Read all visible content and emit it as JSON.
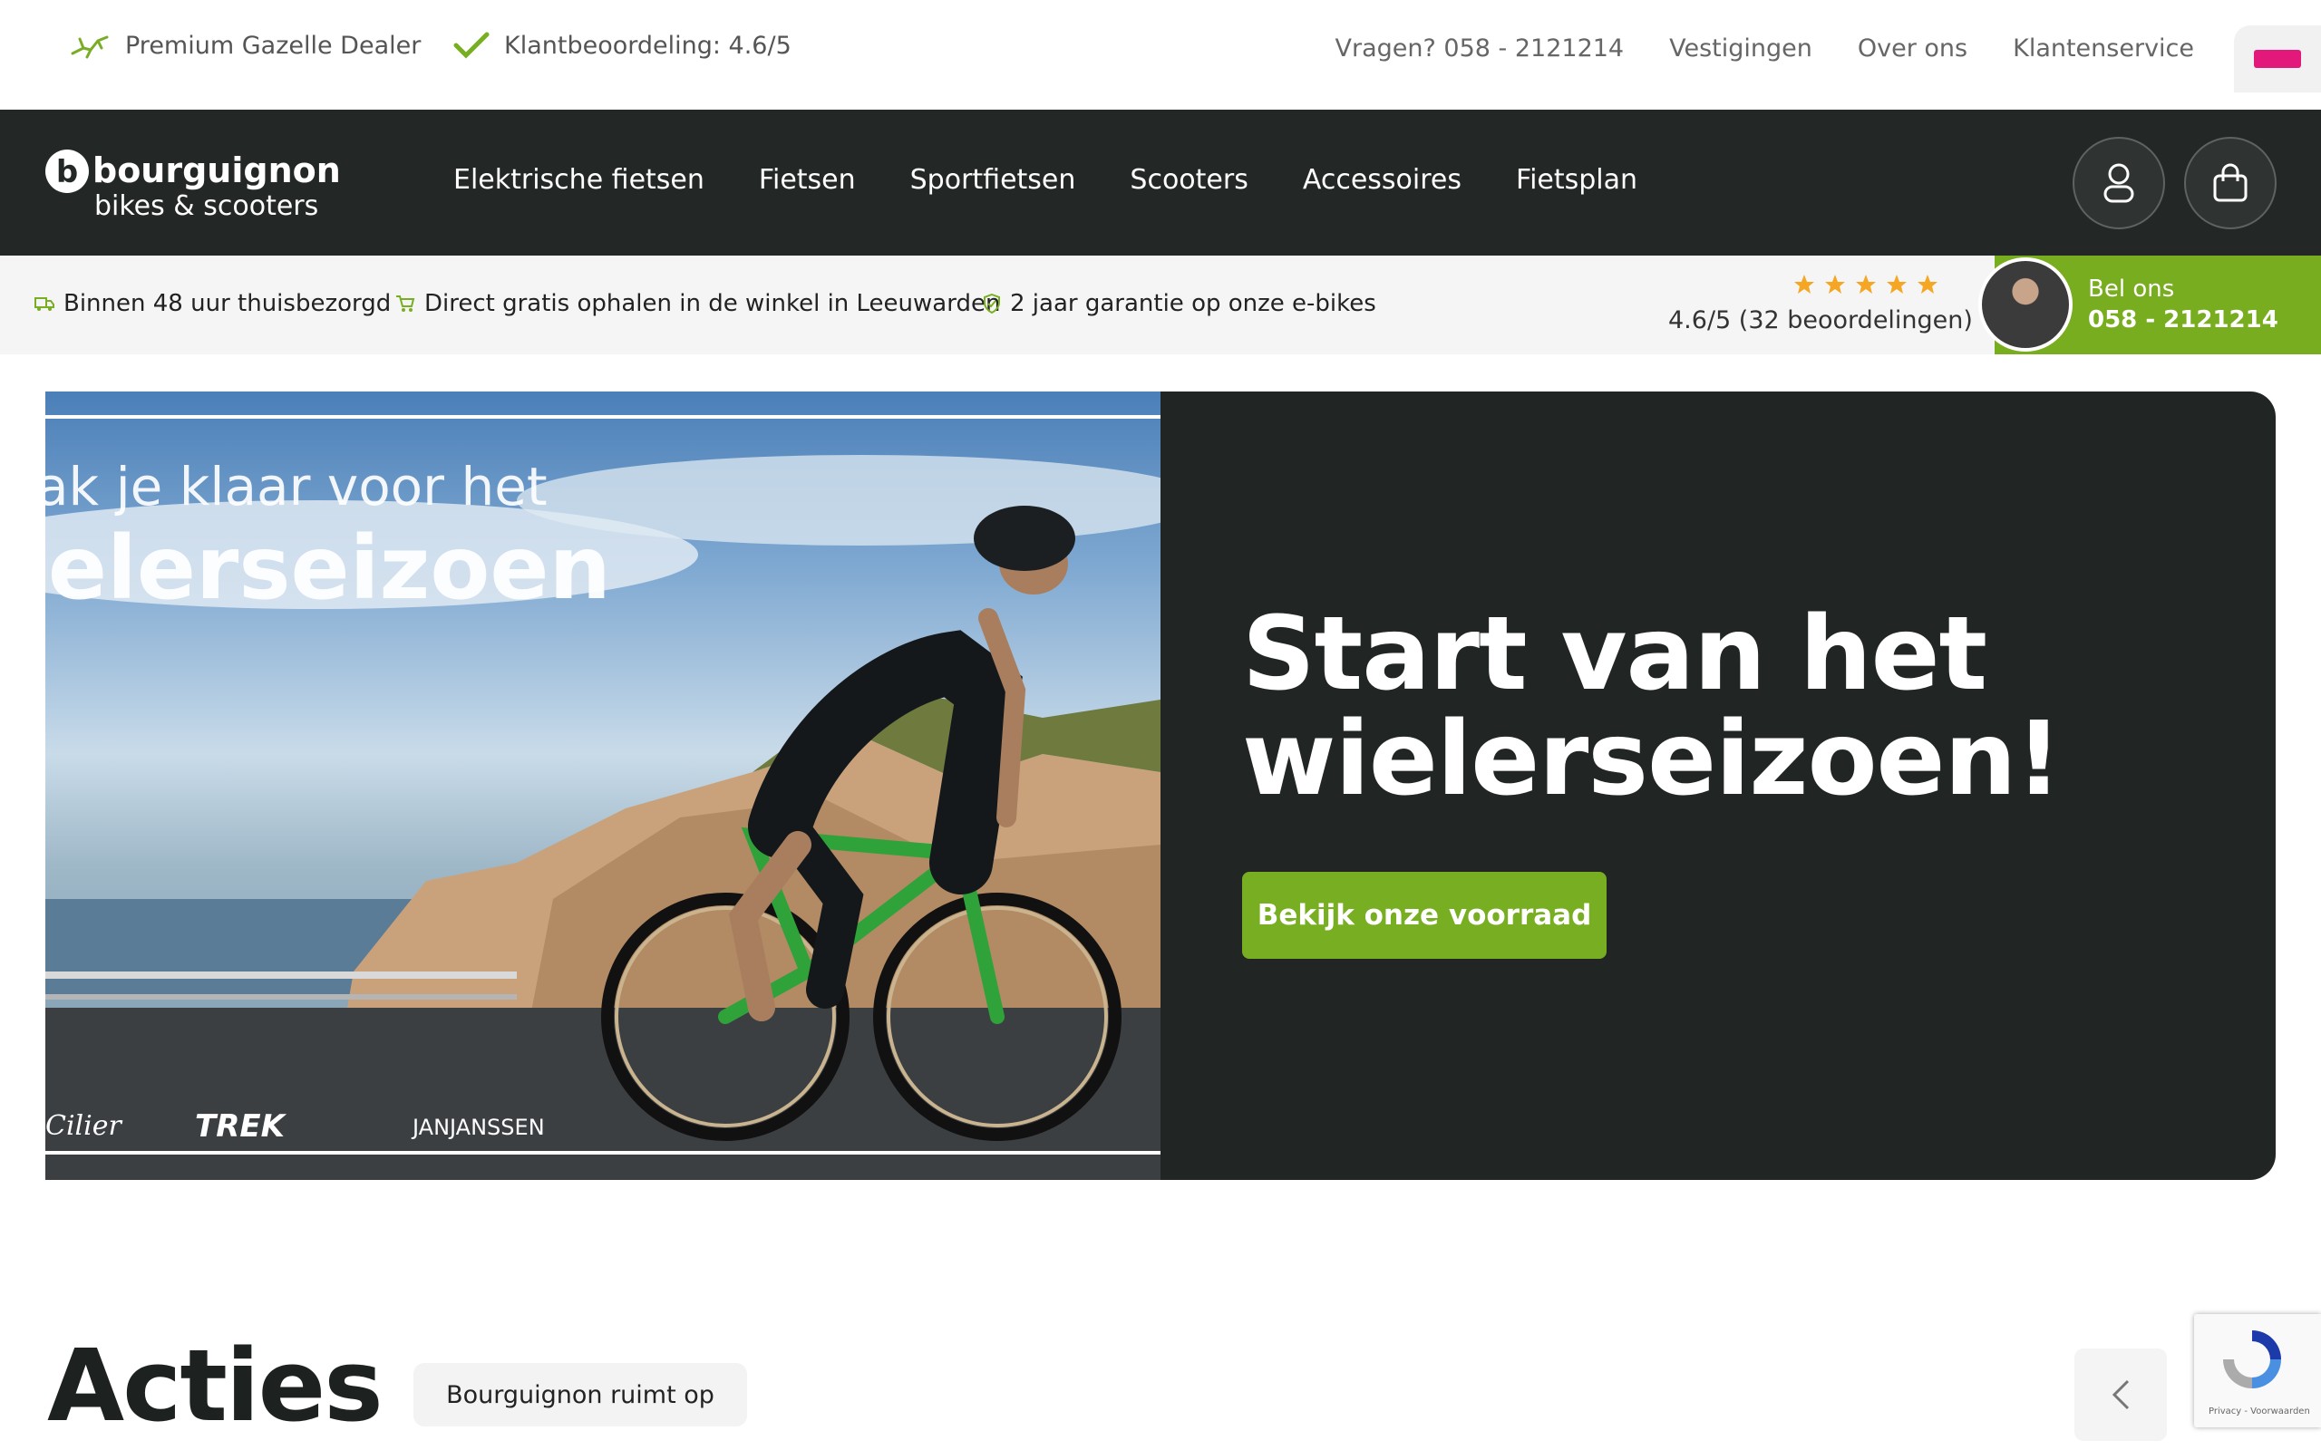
{
  "topbar": {
    "usp_1": "Premium Gazelle Dealer",
    "usp_2": "Klantbeoordeling: 4.6/5",
    "links": [
      "Vragen? 058 - 2121214",
      "Vestigingen",
      "Over ons",
      "Klantenservice"
    ]
  },
  "brand": {
    "name": "bourguignon",
    "tagline": "bikes & scooters"
  },
  "nav": {
    "items": [
      "Elektrische fietsen",
      "Fietsen",
      "Sportfietsen",
      "Scooters",
      "Accessoires",
      "Fietsplan"
    ],
    "account_icon": "user-icon",
    "cart_icon": "shopping-bag-icon"
  },
  "usp_bar": {
    "items": [
      {
        "icon": "truck-icon",
        "text": "Binnen 48 uur thuisbezorgd"
      },
      {
        "icon": "cart-icon",
        "text": "Direct gratis ophalen in de winkel in Leeuwarden"
      },
      {
        "icon": "shield-icon",
        "text": "2 jaar garantie op onze e-bikes"
      }
    ],
    "rating_stars": 5,
    "rating_text": "4.6/5 (32 beoordelingen)",
    "call_label": "Bel ons",
    "call_number": "058 - 2121214"
  },
  "hero": {
    "image_text_1": "ak je klaar voor het",
    "image_text_2": "ieler­seizoen",
    "image_brands": [
      "Cilier",
      "TREK",
      "JANJANSSEN"
    ],
    "title_line_1": "Start van het",
    "title_line_2": "wielerseizoen!",
    "button_label": "Bekijk onze voorraad"
  },
  "acties": {
    "title": "Acties",
    "pill": "Bourguignon ruimt op"
  },
  "recaptcha": {
    "caption": "Privacy - Voorwaarden"
  },
  "colors": {
    "accent": "#78ae21",
    "nav_bg": "#232826",
    "hero_bg": "#212624",
    "star": "#f5a623"
  }
}
